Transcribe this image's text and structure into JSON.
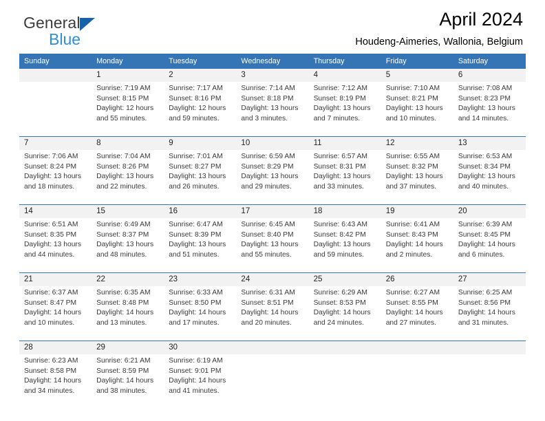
{
  "brand": {
    "line1": "General",
    "line2": "Blue",
    "triangle_color": "#1663ac",
    "line2_color": "#2d8fd5"
  },
  "header": {
    "title": "April 2024",
    "subtitle": "Houdeng-Aimeries, Wallonia, Belgium"
  },
  "theme": {
    "header_blue": "#3575b6",
    "band_gray": "#f2f2f2"
  },
  "calendar": {
    "weekday_headers": [
      "Sunday",
      "Monday",
      "Tuesday",
      "Wednesday",
      "Thursday",
      "Friday",
      "Saturday"
    ],
    "weeks": [
      [
        {
          "day": "",
          "lines": []
        },
        {
          "day": "1",
          "lines": [
            "Sunrise: 7:19 AM",
            "Sunset: 8:15 PM",
            "Daylight: 12 hours",
            "and 55 minutes."
          ]
        },
        {
          "day": "2",
          "lines": [
            "Sunrise: 7:17 AM",
            "Sunset: 8:16 PM",
            "Daylight: 12 hours",
            "and 59 minutes."
          ]
        },
        {
          "day": "3",
          "lines": [
            "Sunrise: 7:14 AM",
            "Sunset: 8:18 PM",
            "Daylight: 13 hours",
            "and 3 minutes."
          ]
        },
        {
          "day": "4",
          "lines": [
            "Sunrise: 7:12 AM",
            "Sunset: 8:19 PM",
            "Daylight: 13 hours",
            "and 7 minutes."
          ]
        },
        {
          "day": "5",
          "lines": [
            "Sunrise: 7:10 AM",
            "Sunset: 8:21 PM",
            "Daylight: 13 hours",
            "and 10 minutes."
          ]
        },
        {
          "day": "6",
          "lines": [
            "Sunrise: 7:08 AM",
            "Sunset: 8:23 PM",
            "Daylight: 13 hours",
            "and 14 minutes."
          ]
        }
      ],
      [
        {
          "day": "7",
          "lines": [
            "Sunrise: 7:06 AM",
            "Sunset: 8:24 PM",
            "Daylight: 13 hours",
            "and 18 minutes."
          ]
        },
        {
          "day": "8",
          "lines": [
            "Sunrise: 7:04 AM",
            "Sunset: 8:26 PM",
            "Daylight: 13 hours",
            "and 22 minutes."
          ]
        },
        {
          "day": "9",
          "lines": [
            "Sunrise: 7:01 AM",
            "Sunset: 8:27 PM",
            "Daylight: 13 hours",
            "and 26 minutes."
          ]
        },
        {
          "day": "10",
          "lines": [
            "Sunrise: 6:59 AM",
            "Sunset: 8:29 PM",
            "Daylight: 13 hours",
            "and 29 minutes."
          ]
        },
        {
          "day": "11",
          "lines": [
            "Sunrise: 6:57 AM",
            "Sunset: 8:31 PM",
            "Daylight: 13 hours",
            "and 33 minutes."
          ]
        },
        {
          "day": "12",
          "lines": [
            "Sunrise: 6:55 AM",
            "Sunset: 8:32 PM",
            "Daylight: 13 hours",
            "and 37 minutes."
          ]
        },
        {
          "day": "13",
          "lines": [
            "Sunrise: 6:53 AM",
            "Sunset: 8:34 PM",
            "Daylight: 13 hours",
            "and 40 minutes."
          ]
        }
      ],
      [
        {
          "day": "14",
          "lines": [
            "Sunrise: 6:51 AM",
            "Sunset: 8:35 PM",
            "Daylight: 13 hours",
            "and 44 minutes."
          ]
        },
        {
          "day": "15",
          "lines": [
            "Sunrise: 6:49 AM",
            "Sunset: 8:37 PM",
            "Daylight: 13 hours",
            "and 48 minutes."
          ]
        },
        {
          "day": "16",
          "lines": [
            "Sunrise: 6:47 AM",
            "Sunset: 8:39 PM",
            "Daylight: 13 hours",
            "and 51 minutes."
          ]
        },
        {
          "day": "17",
          "lines": [
            "Sunrise: 6:45 AM",
            "Sunset: 8:40 PM",
            "Daylight: 13 hours",
            "and 55 minutes."
          ]
        },
        {
          "day": "18",
          "lines": [
            "Sunrise: 6:43 AM",
            "Sunset: 8:42 PM",
            "Daylight: 13 hours",
            "and 59 minutes."
          ]
        },
        {
          "day": "19",
          "lines": [
            "Sunrise: 6:41 AM",
            "Sunset: 8:43 PM",
            "Daylight: 14 hours",
            "and 2 minutes."
          ]
        },
        {
          "day": "20",
          "lines": [
            "Sunrise: 6:39 AM",
            "Sunset: 8:45 PM",
            "Daylight: 14 hours",
            "and 6 minutes."
          ]
        }
      ],
      [
        {
          "day": "21",
          "lines": [
            "Sunrise: 6:37 AM",
            "Sunset: 8:47 PM",
            "Daylight: 14 hours",
            "and 10 minutes."
          ]
        },
        {
          "day": "22",
          "lines": [
            "Sunrise: 6:35 AM",
            "Sunset: 8:48 PM",
            "Daylight: 14 hours",
            "and 13 minutes."
          ]
        },
        {
          "day": "23",
          "lines": [
            "Sunrise: 6:33 AM",
            "Sunset: 8:50 PM",
            "Daylight: 14 hours",
            "and 17 minutes."
          ]
        },
        {
          "day": "24",
          "lines": [
            "Sunrise: 6:31 AM",
            "Sunset: 8:51 PM",
            "Daylight: 14 hours",
            "and 20 minutes."
          ]
        },
        {
          "day": "25",
          "lines": [
            "Sunrise: 6:29 AM",
            "Sunset: 8:53 PM",
            "Daylight: 14 hours",
            "and 24 minutes."
          ]
        },
        {
          "day": "26",
          "lines": [
            "Sunrise: 6:27 AM",
            "Sunset: 8:55 PM",
            "Daylight: 14 hours",
            "and 27 minutes."
          ]
        },
        {
          "day": "27",
          "lines": [
            "Sunrise: 6:25 AM",
            "Sunset: 8:56 PM",
            "Daylight: 14 hours",
            "and 31 minutes."
          ]
        }
      ],
      [
        {
          "day": "28",
          "lines": [
            "Sunrise: 6:23 AM",
            "Sunset: 8:58 PM",
            "Daylight: 14 hours",
            "and 34 minutes."
          ]
        },
        {
          "day": "29",
          "lines": [
            "Sunrise: 6:21 AM",
            "Sunset: 8:59 PM",
            "Daylight: 14 hours",
            "and 38 minutes."
          ]
        },
        {
          "day": "30",
          "lines": [
            "Sunrise: 6:19 AM",
            "Sunset: 9:01 PM",
            "Daylight: 14 hours",
            "and 41 minutes."
          ]
        },
        {
          "day": "",
          "lines": []
        },
        {
          "day": "",
          "lines": []
        },
        {
          "day": "",
          "lines": []
        },
        {
          "day": "",
          "lines": []
        }
      ]
    ]
  }
}
